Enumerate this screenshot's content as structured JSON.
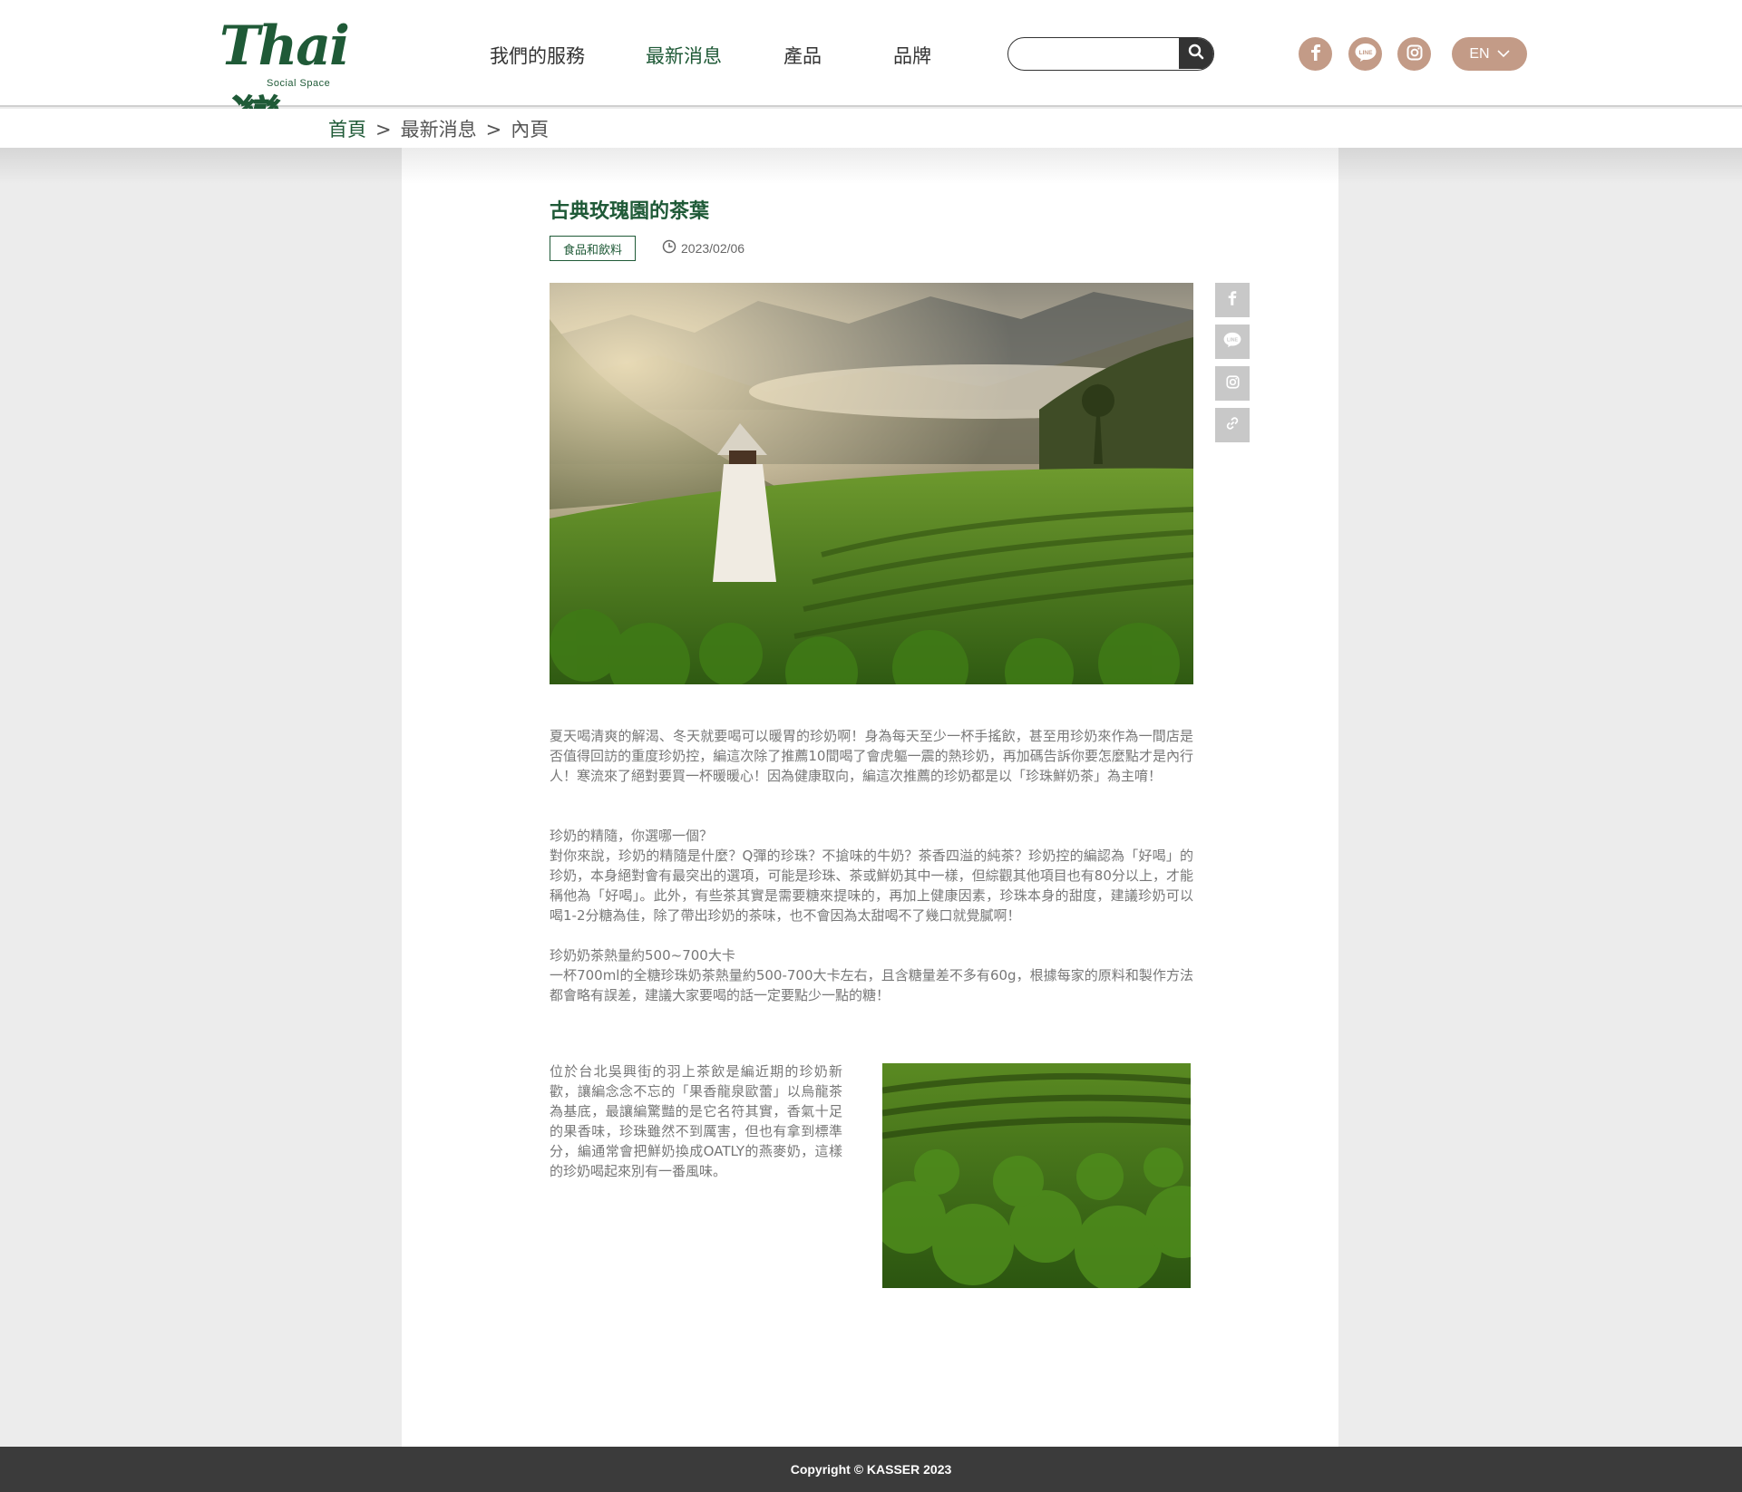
{
  "brand": {
    "logo_text": "Thai灣",
    "logo_sub": "Social Space",
    "color": "#1f5a37",
    "accent": "#c39b87"
  },
  "nav": {
    "items": [
      {
        "label": "我們的服務"
      },
      {
        "label": "最新消息"
      },
      {
        "label": "產品"
      },
      {
        "label": "品牌"
      }
    ],
    "active_index": 1
  },
  "search": {
    "placeholder": "",
    "icon": "search-icon"
  },
  "social_icons": [
    "facebook-icon",
    "line-icon",
    "instagram-icon"
  ],
  "language": {
    "selected": "EN",
    "icon": "chevron-down-icon"
  },
  "breadcrumb": {
    "home": "首頁",
    "news": "最新消息",
    "current": "內頁",
    "separator": ">"
  },
  "article": {
    "title": "古典玫瑰園的茶葉",
    "category": "食品和飲料",
    "date": "2023/02/06",
    "paragraph_1": "夏天喝清爽的解渴、冬天就要喝可以暖胃的珍奶啊！身為每天至少一杯手搖飲，甚至用珍奶來作為一間店是否值得回訪的重度珍奶控，編這次除了推薦10間喝了會虎軀一震的熱珍奶，再加碼告訴你要怎麼點才是內行人！寒流來了絕對要買一杯暖暖心！因為健康取向，編這次推薦的珍奶都是以「珍珠鮮奶茶」為主唷！",
    "heading_2": "珍奶的精隨，你選哪一個？",
    "paragraph_2": "對你來說，珍奶的精隨是什麼？Q彈的珍珠？不搶味的牛奶？茶香四溢的純茶？珍奶控的編認為「好喝」的珍奶，本身絕對會有最突出的選項，可能是珍珠、茶或鮮奶其中一樣，但綜觀其他項目也有80分以上，才能稱他為「好喝」。此外，有些茶其實是需要糖來提味的，再加上健康因素，珍珠本身的甜度，建議珍奶可以喝1-2分糖為佳，除了帶出珍奶的茶味，也不會因為太甜喝不了幾口就覺膩啊！",
    "heading_3": "珍奶奶茶熱量約500~700大卡",
    "paragraph_3": "一杯700ml的全糖珍珠奶茶熱量約500-700大卡左右，且含糖量差不多有60g，根據每家的原料和製作方法都會略有誤差，建議大家要喝的話一定要點少一點的糖！",
    "side_paragraph": "位於台北吳興街的羽上茶飲是編近期的珍奶新歡，讓編念念不忘的「果香龍泉歐蕾」以烏龍茶為基底，最讓編驚豔的是它名符其實，香氣十足的果香味，珍珠雖然不到厲害，但也有拿到標準分，編通常會把鮮奶換成OATLY的燕麥奶，這樣的珍奶喝起來別有一番風味。"
  },
  "share_icons": [
    "facebook-icon",
    "line-icon",
    "instagram-icon",
    "link-icon"
  ],
  "footer": {
    "copyright": "Copyright © KASSER 2023"
  }
}
